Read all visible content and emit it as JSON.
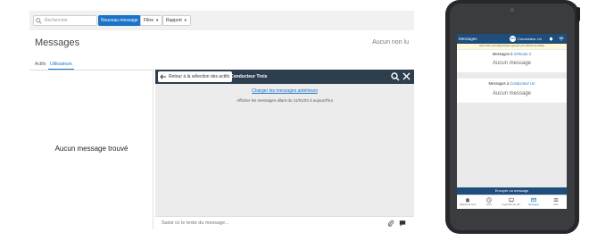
{
  "desktop": {
    "search": {
      "placeholder": "Rechercher"
    },
    "toolbar": {
      "new_message": "Nouveau message",
      "filters": "Filtre",
      "report": "Rapport"
    },
    "title": "Messages",
    "unread": "Aucun non lu",
    "tabs": [
      {
        "label": "Actifs",
        "active": false
      },
      {
        "label": "Utilisateurs",
        "active": true
      }
    ],
    "empty_state": "Aucun message trouvé",
    "chat": {
      "back_label": "Retour à la sélection des actifs",
      "name": "Conducteur Trois",
      "load_previous": "Charger les messages antérieurs",
      "show_from": "Afficher les messages allant du 11/01/22 à aujourd'hui",
      "input_placeholder": "Saisir ici le texte du message..."
    },
    "colors": {
      "accent": "#1a73c8",
      "header": "#2d3e4f"
    }
  },
  "tablet": {
    "header_title": "Messages",
    "user_initials": "CU",
    "user_name": "Conducteur Un",
    "banner": "Votre GO1 a été diagnostiqué. Appuyez pour afficher les détails",
    "cards": [
      {
        "prefix": "Messages à",
        "target": "Véhicule 2",
        "body": "Aucun message"
      },
      {
        "prefix": "Messages à",
        "target": "Conducteur Un",
        "body": "Aucun message"
      }
    ],
    "send_button": "Envoyer un message",
    "nav": [
      {
        "label": "Tableau de bord",
        "icon": "home-icon",
        "active": false
      },
      {
        "label": "HOS",
        "icon": "clock-icon",
        "active": false
      },
      {
        "label": "Inspection du véh.",
        "icon": "truck-icon",
        "active": false
      },
      {
        "label": "Messages",
        "icon": "mail-icon",
        "active": true
      },
      {
        "label": "Plus",
        "icon": "menu-icon",
        "active": false
      }
    ],
    "colors": {
      "header": "#1d4e7e",
      "banner": "#fff8d6"
    }
  }
}
